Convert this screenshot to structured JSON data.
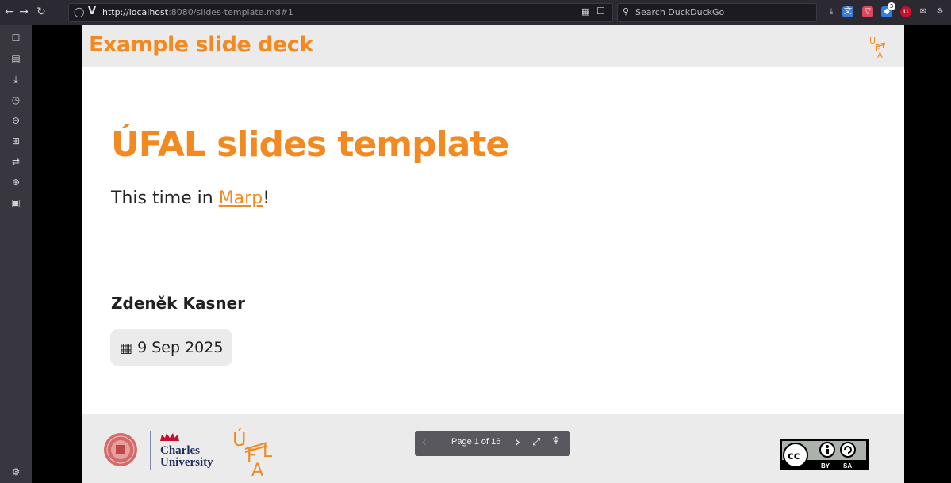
{
  "browser": {
    "url_host": "http://localhost",
    "url_rest": ":8080/slides-template.md#1",
    "search_placeholder": "Search DuckDuckGo",
    "ext_badge": "3"
  },
  "slide": {
    "deck_title": "Example slide deck",
    "title": "ÚFAL slides template",
    "subtitle_prefix": "This time in ",
    "subtitle_link": "Marp",
    "subtitle_suffix": "!",
    "author": "Zdeněk Kasner",
    "date": "9 Sep 2025",
    "university_line1": "Charles",
    "university_line2": "University"
  },
  "pager": {
    "label": "Page 1 of 16"
  },
  "license": {
    "by": "BY",
    "sa": "SA"
  },
  "colors": {
    "accent": "#f28a21",
    "header_bg": "#ebebeb"
  }
}
